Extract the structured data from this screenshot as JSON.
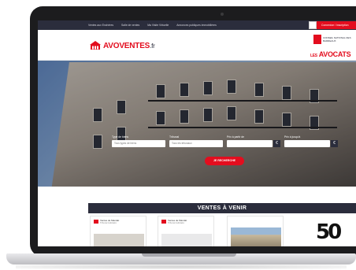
{
  "topnav": {
    "items": [
      "Ventes aux Enchères",
      "Salle de ventes",
      "Ma Visite Virtuelle",
      "Annonces publiques immobilières"
    ],
    "login_label": "Connexion / Inscription"
  },
  "header": {
    "logo_main": "AVOVENTES",
    "logo_suffix": ".fr",
    "cnb_lines": "CONSEIL NATIONAL DES BARREAUX",
    "les": "LES",
    "avocats": "AVOCATS"
  },
  "search": {
    "type_label": "Type de biens",
    "type_placeholder": "Tous types de biens",
    "tribunal_label": "Tribunal",
    "tribunal_placeholder": "Tous les tribunaux",
    "prix_min_label": "Prix à partir de",
    "prix_max_label": "Prix à jusqu'à",
    "unit": "€",
    "button_label": "JE RECHERCHE"
  },
  "ventes": {
    "title": "VENTES À VENIR",
    "cards": [
      {
        "title": "Ventes de Mandat",
        "sub": "Tribunal Judiciaire"
      },
      {
        "title": "Ventes de Mandat",
        "sub": "Tribunal Judiciaire"
      },
      {
        "title": "",
        "sub": ""
      }
    ],
    "badge": "50"
  },
  "colors": {
    "brand_red": "#e30d1e",
    "navy": "#2b2d3c"
  }
}
